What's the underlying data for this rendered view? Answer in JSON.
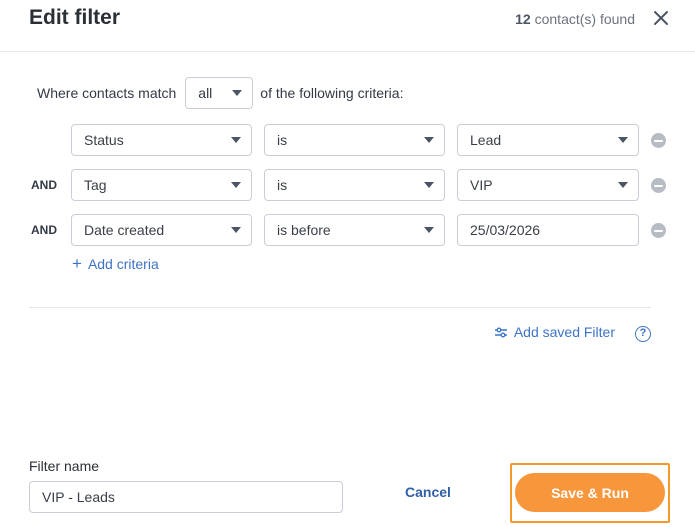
{
  "header": {
    "title": "Edit filter",
    "found_count": "12",
    "found_label": "contact(s) found"
  },
  "match": {
    "prefix": "Where contacts match",
    "selected": "all",
    "suffix": "of the following criteria:"
  },
  "criteria": [
    {
      "conjunction": "",
      "field": "Status",
      "operator": "is",
      "value": "Lead",
      "value_type": "select"
    },
    {
      "conjunction": "AND",
      "field": "Tag",
      "operator": "is",
      "value": "VIP",
      "value_type": "select"
    },
    {
      "conjunction": "AND",
      "field": "Date created",
      "operator": "is before",
      "value": "25/03/2026",
      "value_type": "input"
    }
  ],
  "add_criteria_label": "Add criteria",
  "saved_filter_label": "Add saved Filter",
  "help_label": "?",
  "filter_name": {
    "label": "Filter name",
    "value": "VIP - Leads"
  },
  "buttons": {
    "cancel": "Cancel",
    "save_run": "Save & Run"
  },
  "colors": {
    "accent_orange": "#f7963a",
    "link_blue": "#3d73c6"
  }
}
